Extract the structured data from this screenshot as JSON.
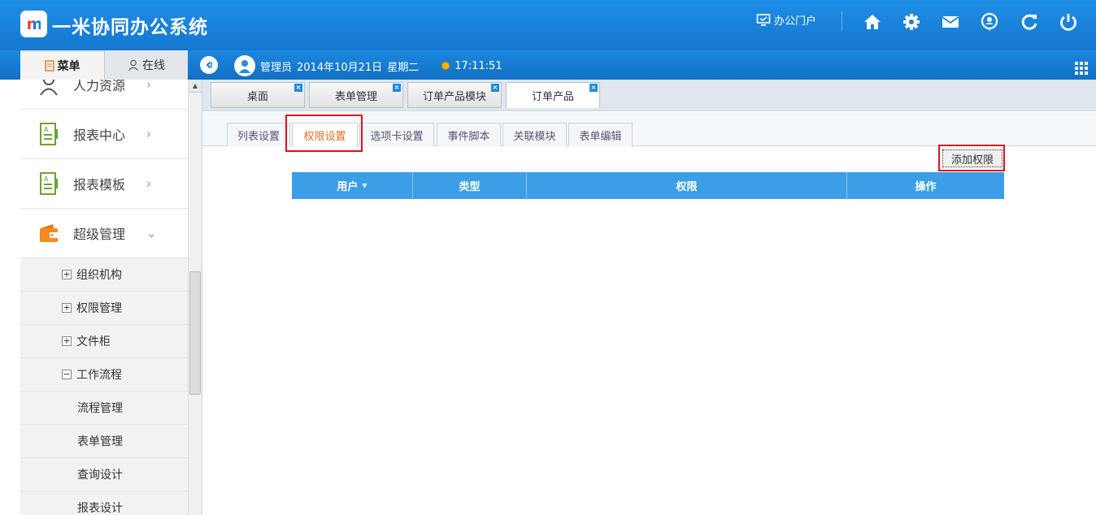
{
  "app": {
    "logo_text": "m",
    "title": "一米协同办公系统"
  },
  "header": {
    "portal_label": "办公门户"
  },
  "left_tabs": [
    {
      "label": "菜单"
    },
    {
      "label": "在线"
    }
  ],
  "user_bar": {
    "role": "管理员",
    "date": "2014年10月21日",
    "weekday": "星期二",
    "time": "17:11:51"
  },
  "sidebar": {
    "menu": [
      {
        "label": "人力资源",
        "arrow": "›"
      },
      {
        "label": "报表中心",
        "arrow": "›"
      },
      {
        "label": "报表模板",
        "arrow": "›"
      },
      {
        "label": "超级管理",
        "arrow": "⌄"
      }
    ],
    "sub": [
      {
        "label": "组织机构",
        "expander": "+"
      },
      {
        "label": "权限管理",
        "expander": "+"
      },
      {
        "label": "文件柜",
        "expander": "+"
      },
      {
        "label": "工作流程",
        "expander": "−"
      }
    ],
    "leaf": [
      {
        "label": "流程管理"
      },
      {
        "label": "表单管理"
      },
      {
        "label": "查询设计"
      },
      {
        "label": "报表设计"
      }
    ]
  },
  "page_tabs": [
    {
      "label": "桌面",
      "close": "×"
    },
    {
      "label": "表单管理",
      "close": "×"
    },
    {
      "label": "订单产品模块",
      "close": "×"
    },
    {
      "label": "订单产品",
      "close": "×"
    }
  ],
  "settings_tabs": [
    {
      "label": "列表设置"
    },
    {
      "label": "权限设置"
    },
    {
      "label": "选项卡设置"
    },
    {
      "label": "事件脚本"
    },
    {
      "label": "关联模块"
    },
    {
      "label": "表单编辑"
    }
  ],
  "add_button": "添加权限",
  "table": {
    "columns": [
      "用户",
      "类型",
      "权限",
      "操作"
    ],
    "sort_indicator": "▼"
  }
}
